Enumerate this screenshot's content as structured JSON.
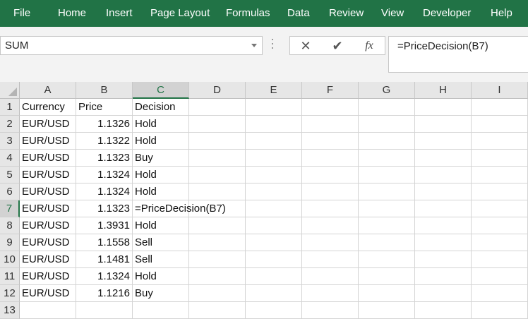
{
  "ribbon": {
    "tabs": [
      "File",
      "Home",
      "Insert",
      "Page Layout",
      "Formulas",
      "Data",
      "Review",
      "View",
      "Developer",
      "Help"
    ]
  },
  "formula_bar": {
    "name_box": "SUM",
    "cancel_glyph": "✕",
    "enter_glyph": "✔",
    "fx_label": "fx",
    "formula": "=PriceDecision(B7)"
  },
  "sheet": {
    "columns": [
      "A",
      "B",
      "C",
      "D",
      "E",
      "F",
      "G",
      "H",
      "I"
    ],
    "row_numbers": [
      "1",
      "2",
      "3",
      "4",
      "5",
      "6",
      "7",
      "8",
      "9",
      "10",
      "11",
      "12",
      "13"
    ],
    "active_cell": "C7",
    "rows": [
      [
        "Currency",
        "Price",
        "Decision"
      ],
      [
        "EUR/USD",
        "1.1326",
        "Hold"
      ],
      [
        "EUR/USD",
        "1.1322",
        "Hold"
      ],
      [
        "EUR/USD",
        "1.1323",
        "Buy"
      ],
      [
        "EUR/USD",
        "1.1324",
        "Hold"
      ],
      [
        "EUR/USD",
        "1.1324",
        "Hold"
      ],
      [
        "EUR/USD",
        "1.1323",
        "=PriceDecision(B7)"
      ],
      [
        "EUR/USD",
        "1.3931",
        "Hold"
      ],
      [
        "EUR/USD",
        "1.1558",
        "Sell"
      ],
      [
        "EUR/USD",
        "1.1481",
        "Sell"
      ],
      [
        "EUR/USD",
        "1.1324",
        "Hold"
      ],
      [
        "EUR/USD",
        "1.1216",
        "Buy"
      ],
      [
        "",
        "",
        ""
      ]
    ]
  },
  "colors": {
    "ribbon": "#217346",
    "accent": "#217346"
  }
}
